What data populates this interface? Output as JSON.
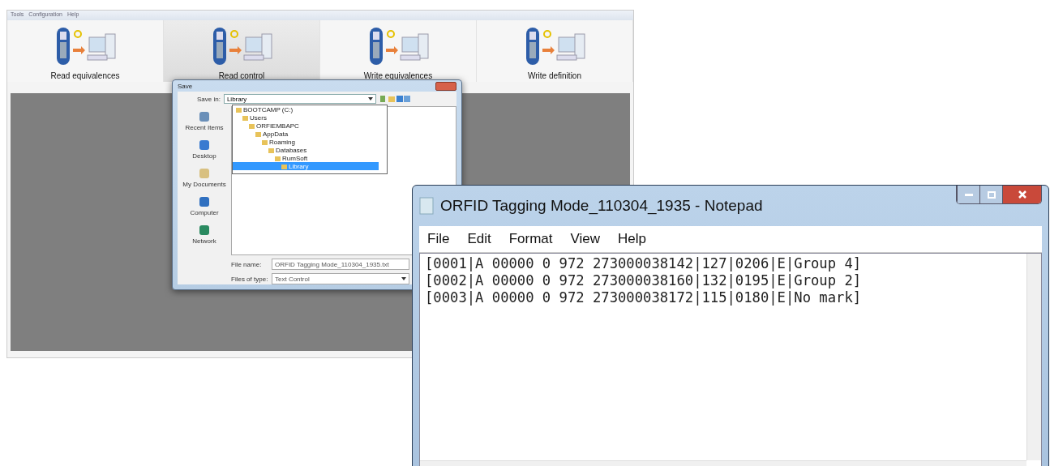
{
  "app": {
    "menu": [
      "Tools",
      "Configuration",
      "Help"
    ],
    "toolbar": [
      {
        "label": "Read equivalences",
        "selected": false
      },
      {
        "label": "Read control",
        "selected": true
      },
      {
        "label": "Write equivalences",
        "selected": false
      },
      {
        "label": "Write definition",
        "selected": false
      }
    ]
  },
  "save_dialog": {
    "title": "Save",
    "save_in_label": "Save in:",
    "save_in": "Library",
    "folders": [
      {
        "name": "BOOTCAMP (C:)",
        "selected": false,
        "children": [
          {
            "name": "Users",
            "selected": false,
            "children": [
              {
                "name": "ORFIEMBAPC",
                "selected": false,
                "children": [
                  {
                    "name": "AppData",
                    "selected": false,
                    "children": [
                      {
                        "name": "Roaming",
                        "selected": false,
                        "children": [
                          {
                            "name": "Databases",
                            "selected": false,
                            "children": [
                              {
                                "name": "RumSoft",
                                "selected": false,
                                "children": [
                                  {
                                    "name": "Library",
                                    "selected": true
                                  }
                                ]
                              }
                            ]
                          }
                        ]
                      }
                    ]
                  }
                ]
              }
            ]
          }
        ]
      }
    ],
    "places": [
      "Recent Items",
      "Desktop",
      "My Documents",
      "Computer",
      "Network"
    ],
    "file_name_label": "File name:",
    "file_name": "ORFID Tagging Mode_110304_1935.txt",
    "file_type_label": "Files of type:",
    "file_type": "Text Control"
  },
  "notepad": {
    "title": "ORFID Tagging Mode_110304_1935 - Notepad",
    "menu": [
      "File",
      "Edit",
      "Format",
      "View",
      "Help"
    ],
    "lines": [
      "[0001|A 00000 0 972 273000038142|127|0206|E|Group 4]",
      "[0002|A 00000 0 972 273000038160|132|0195|E|Group 2]",
      "[0003|A 00000 0 972 273000038172|115|0180|E|No mark]"
    ]
  }
}
